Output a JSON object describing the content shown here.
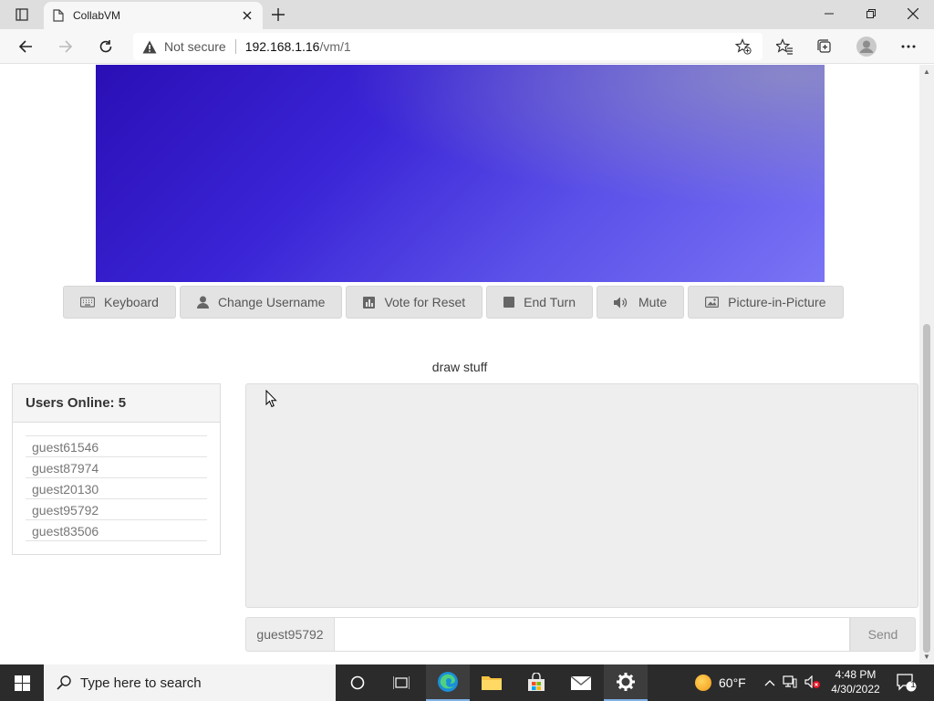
{
  "browser": {
    "tab_title": "CollabVM",
    "security_label": "Not secure",
    "url_host": "192.168.1.16",
    "url_path": "/vm/1"
  },
  "vm": {
    "buttons": [
      {
        "label": "Keyboard",
        "icon": "keyboard-icon"
      },
      {
        "label": "Change Username",
        "icon": "user-icon"
      },
      {
        "label": "Vote for Reset",
        "icon": "chart-icon"
      },
      {
        "label": "End Turn",
        "icon": "stop-icon"
      },
      {
        "label": "Mute",
        "icon": "speaker-icon"
      },
      {
        "label": "Picture-in-Picture",
        "icon": "picture-icon"
      }
    ],
    "title": "draw stuff"
  },
  "users": {
    "header": "Users Online: 5",
    "list": [
      "guest61546",
      "guest87974",
      "guest20130",
      "guest95792",
      "guest83506"
    ]
  },
  "chat": {
    "nickname": "guest95792",
    "input_value": "",
    "send_label": "Send"
  },
  "taskbar": {
    "search_placeholder": "Type here to search",
    "weather": "60°F",
    "time": "4:48 PM",
    "date": "4/30/2022",
    "notification_count": "1"
  }
}
